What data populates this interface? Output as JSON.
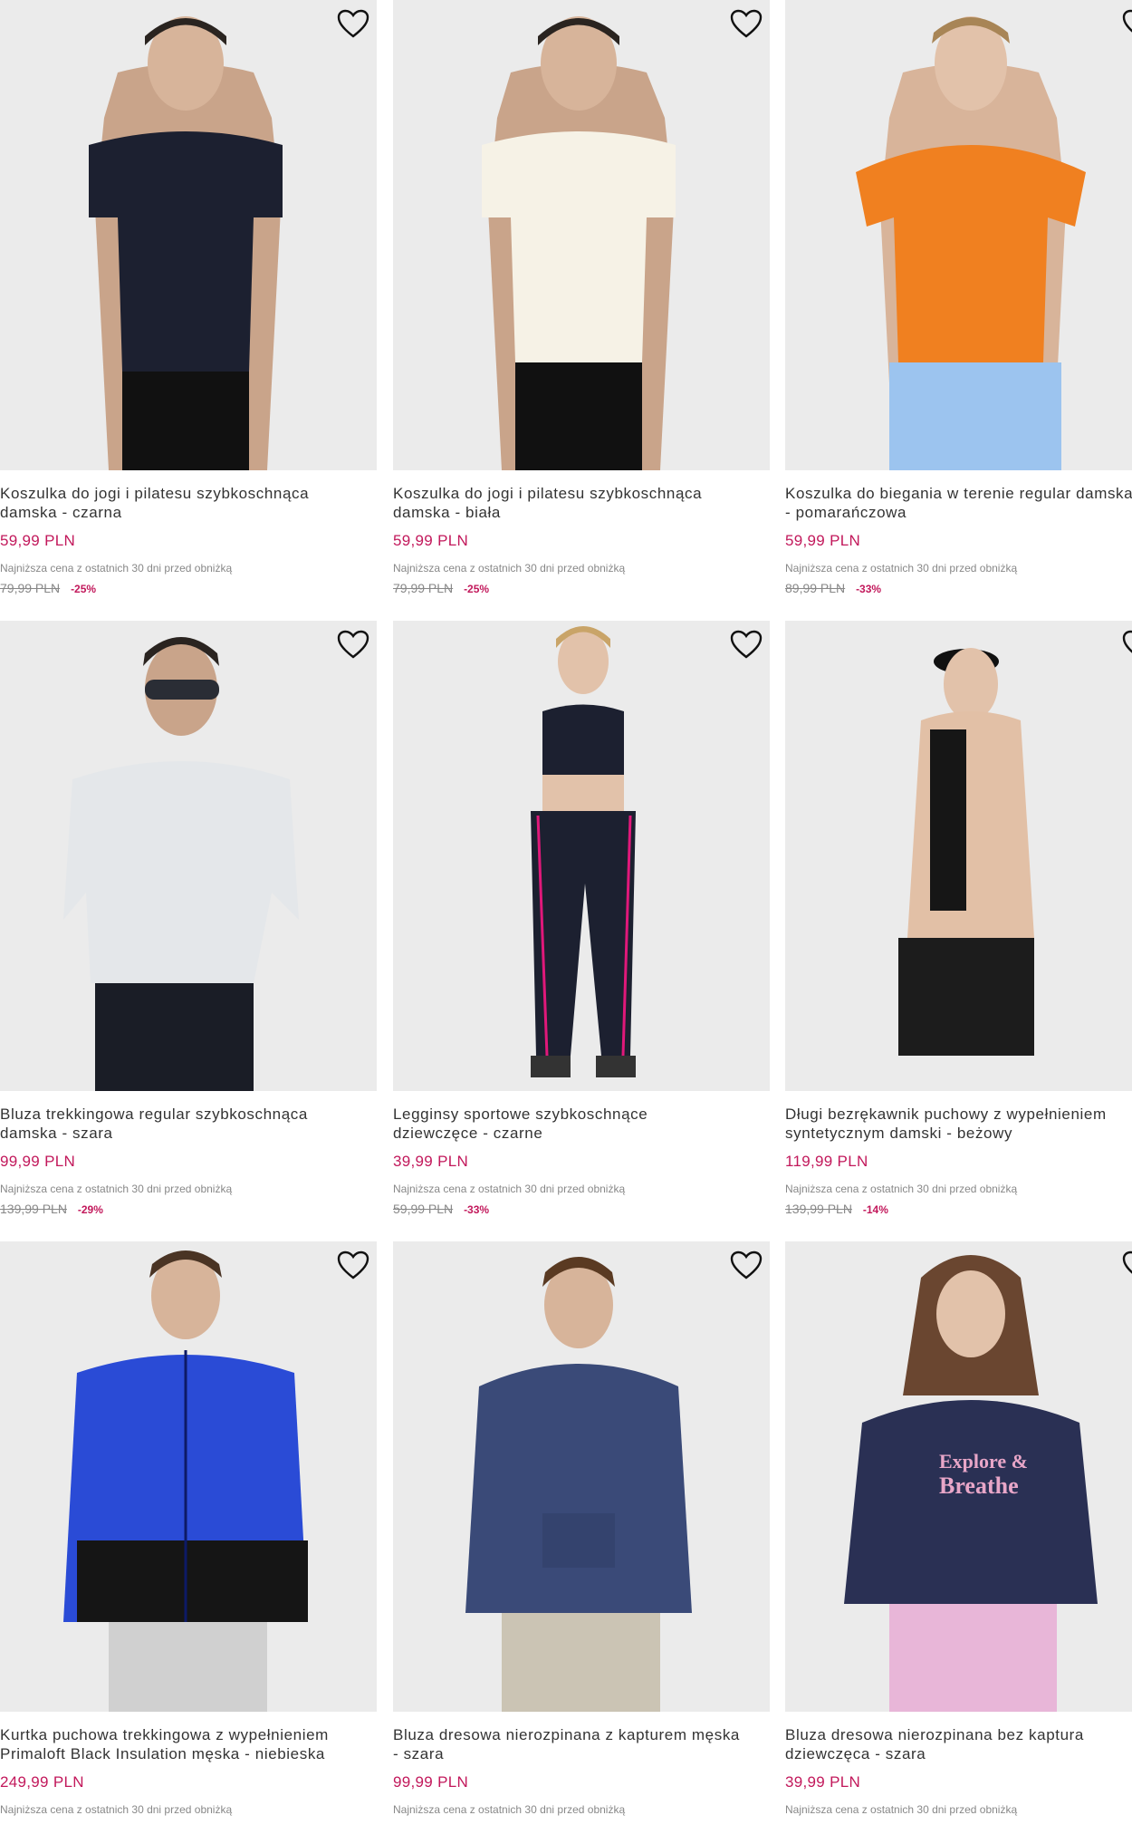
{
  "products": [
    {
      "title": "Koszulka do jogi i pilatesu szybkoschnąca\ndamska - czarna",
      "price": "59,99 PLN",
      "lowest_label": "Najniższa cena z ostatnich 30 dni przed obniżką",
      "old_price": "79,99 PLN",
      "discount": "-25%",
      "wishlist_icon": "heart-outline-icon"
    },
    {
      "title": "Koszulka do jogi i pilatesu szybkoschnąca\ndamska - biała",
      "price": "59,99 PLN",
      "lowest_label": "Najniższa cena z ostatnich 30 dni przed obniżką",
      "old_price": "79,99 PLN",
      "discount": "-25%",
      "wishlist_icon": "heart-outline-icon"
    },
    {
      "title": "Koszulka do biegania w terenie regular damska\n- pomarańczowa",
      "price": "59,99 PLN",
      "lowest_label": "Najniższa cena z ostatnich 30 dni przed obniżką",
      "old_price": "89,99 PLN",
      "discount": "-33%",
      "wishlist_icon": "heart-outline-icon"
    },
    {
      "title": "Bluza trekkingowa regular szybkoschnąca\ndamska - szara",
      "price": "99,99 PLN",
      "lowest_label": "Najniższa cena z ostatnich 30 dni przed obniżką",
      "old_price": "139,99 PLN",
      "discount": "-29%",
      "wishlist_icon": "heart-outline-icon"
    },
    {
      "title": "Legginsy sportowe szybkoschnące\ndziewczęce - czarne",
      "price": "39,99 PLN",
      "lowest_label": "Najniższa cena z ostatnich 30 dni przed obniżką",
      "old_price": "59,99 PLN",
      "discount": "-33%",
      "wishlist_icon": "heart-outline-icon"
    },
    {
      "title": "Długi bezrękawnik puchowy z wypełnieniem\nsyntetycznym damski - beżowy",
      "price": "119,99 PLN",
      "lowest_label": "Najniższa cena z ostatnich 30 dni przed obniżką",
      "old_price": "139,99 PLN",
      "discount": "-14%",
      "wishlist_icon": "heart-outline-icon"
    },
    {
      "title": "Kurtka puchowa trekkingowa z wypełnieniem\nPrimaloft Black Insulation męska - niebieska",
      "price": "249,99 PLN",
      "lowest_label": "Najniższa cena z ostatnich 30 dni przed obniżką",
      "old_price": "",
      "discount": "",
      "wishlist_icon": "heart-outline-icon"
    },
    {
      "title": "Bluza dresowa nierozpinana z kapturem męska\n- szara",
      "price": "99,99 PLN",
      "lowest_label": "Najniższa cena z ostatnich 30 dni przed obniżką",
      "old_price": "",
      "discount": "",
      "wishlist_icon": "heart-outline-icon"
    },
    {
      "title": "Bluza dresowa nierozpinana bez kaptura\ndziewczęca - szara",
      "price": "39,99 PLN",
      "lowest_label": "Najniższa cena z ostatnich 30 dni przed obniżką",
      "old_price": "",
      "discount": "",
      "wishlist_icon": "heart-outline-icon"
    }
  ],
  "print_text": {
    "line1": "Explore &",
    "line2": "Breathe"
  },
  "colors": {
    "price": "#c2185b",
    "image_bg": "#ececec"
  }
}
